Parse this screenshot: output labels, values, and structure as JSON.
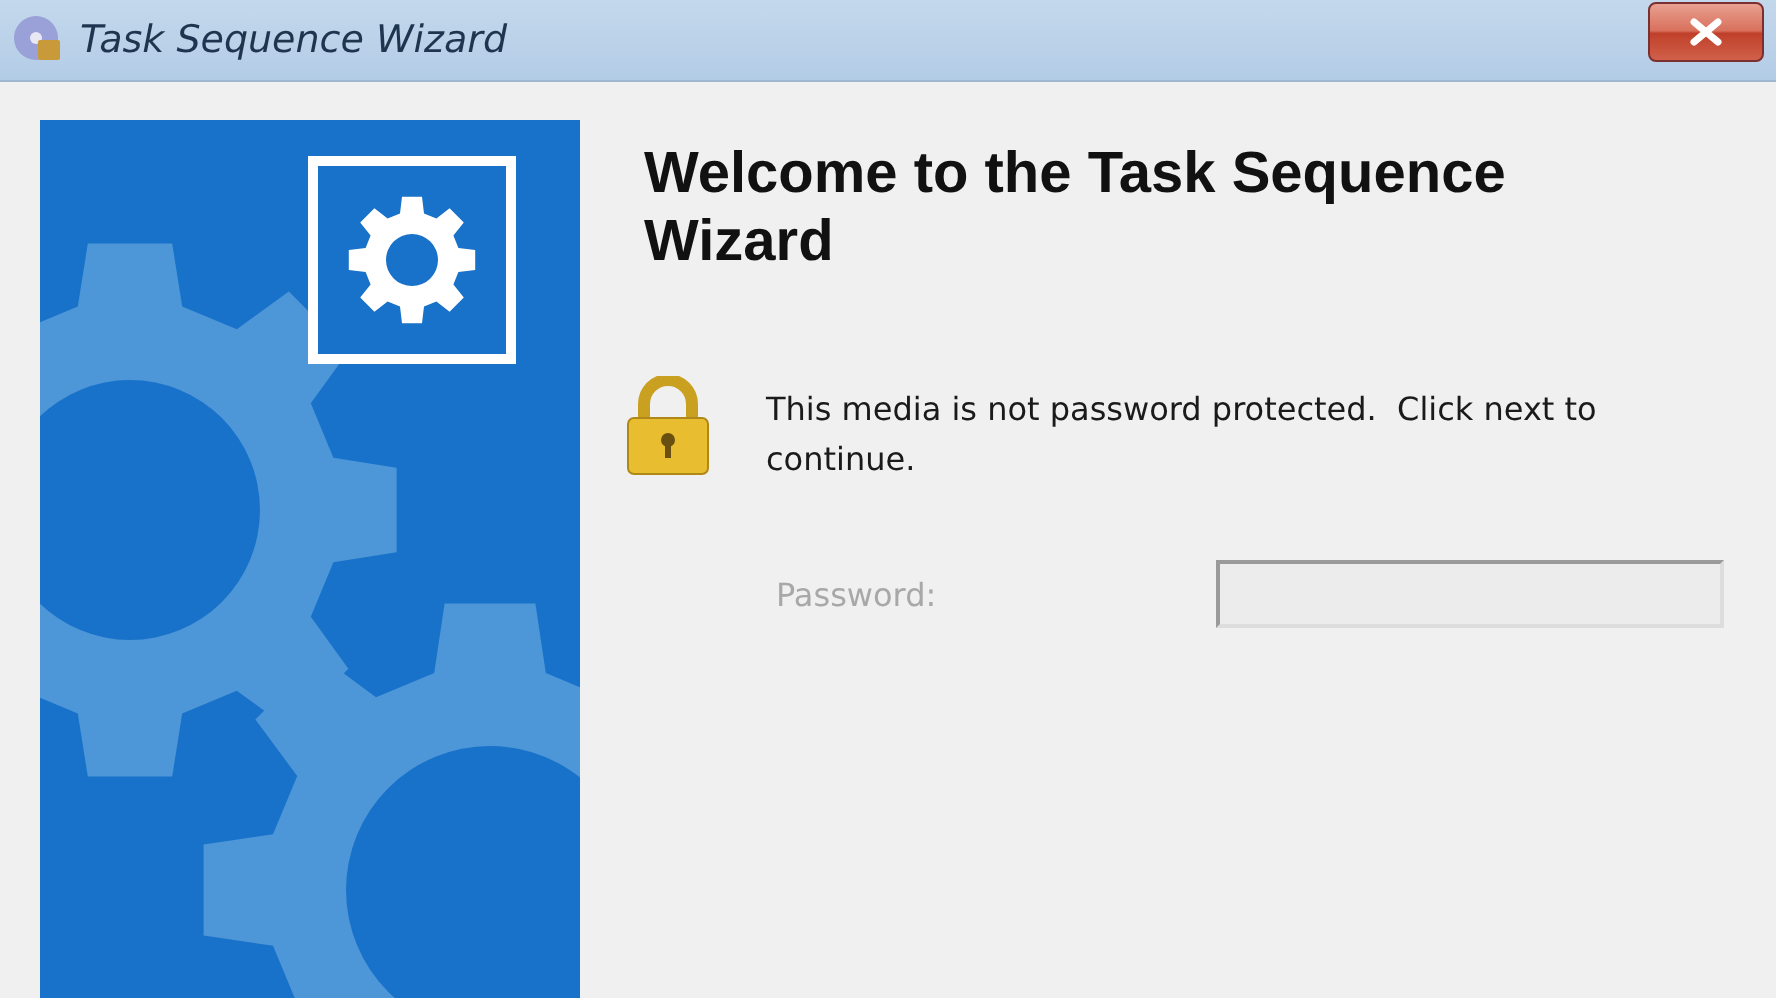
{
  "window": {
    "title": "Task Sequence Wizard"
  },
  "heading": "Welcome to the Task Sequence Wizard",
  "message": "This media is not password protected.  Click next to continue.",
  "password": {
    "label": "Password:",
    "disabled": true
  }
}
